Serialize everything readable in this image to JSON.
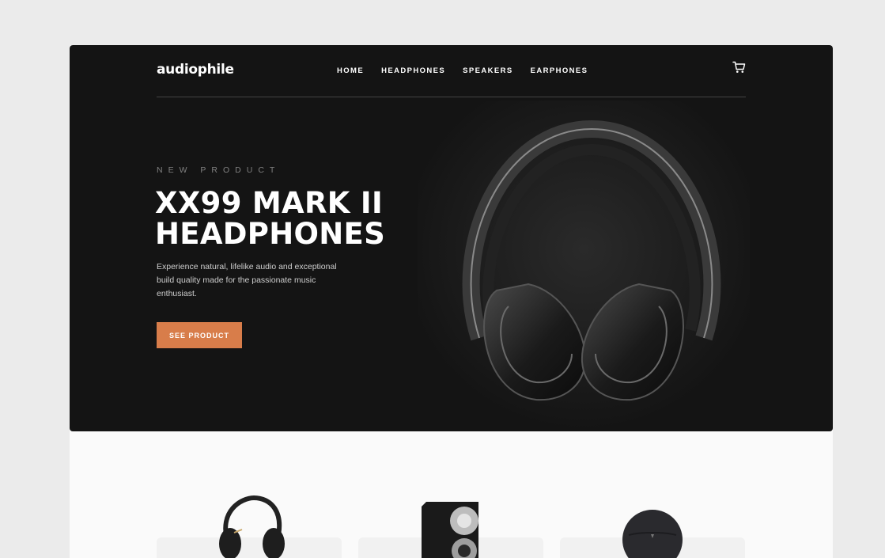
{
  "brand": {
    "name": "audiophile",
    "accent": "#D87D4A"
  },
  "nav": {
    "items": [
      {
        "label": "HOME"
      },
      {
        "label": "HEADPHONES"
      },
      {
        "label": "SPEAKERS"
      },
      {
        "label": "EARPHONES"
      }
    ],
    "cart_icon": "shopping-cart-icon"
  },
  "hero": {
    "overline": "NEW PRODUCT",
    "title_line1": "XX99 MARK II",
    "title_line2": "HEADPHONES",
    "description": "Experience natural, lifelike audio and exceptional build quality made for the passionate music enthusiast.",
    "cta_label": "SEE PRODUCT",
    "image": "xx99-mark-ii-headphones-image"
  },
  "categories": [
    {
      "image": "headphones-thumbnail"
    },
    {
      "image": "speaker-thumbnail"
    },
    {
      "image": "earphones-thumbnail"
    }
  ],
  "colors": {
    "hero_bg": "#141414",
    "page_bg": "#FAFAFA",
    "card_bg": "#F1F1F1"
  }
}
